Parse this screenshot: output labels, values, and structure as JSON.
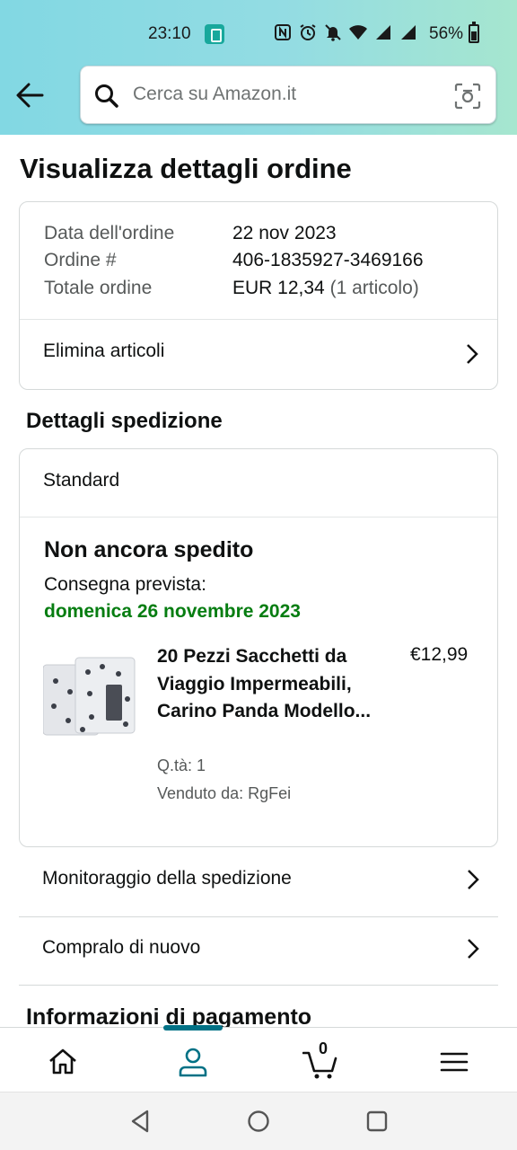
{
  "status_bar": {
    "time": "23:10",
    "battery": "56%",
    "icons": [
      "nfc-icon",
      "alarm-icon",
      "mute-icon",
      "wifi-icon",
      "signal-icon",
      "signal-icon",
      "battery-icon"
    ]
  },
  "header": {
    "search_placeholder": "Cerca su Amazon.it"
  },
  "page": {
    "title": "Visualizza dettagli ordine"
  },
  "order_summary": {
    "date_label": "Data dell'ordine",
    "date_value": "22 nov 2023",
    "order_label": "Ordine #",
    "order_value": "406-1835927-3469166",
    "total_label": "Totale ordine",
    "total_value": "EUR 12,34",
    "total_count": "(1 articolo)",
    "delete_items": "Elimina articoli"
  },
  "shipping": {
    "section_title": "Dettagli spedizione",
    "method": "Standard",
    "status": "Non ancora spedito",
    "delivery_label": "Consegna prevista:",
    "delivery_date": "domenica 26 novembre 2023",
    "product": {
      "name": "20 Pezzi Sacchetti da Viaggio Impermeabili, Carino Panda Modello...",
      "price": "€12,99",
      "qty": "Q.tà: 1",
      "seller": "Venduto da: RgFei"
    }
  },
  "actions": {
    "track": "Monitoraggio della spedizione",
    "buy_again": "Compralo di nuovo"
  },
  "payment": {
    "section_title": "Informazioni di pagamento"
  },
  "bottom_nav": {
    "cart_count": "0",
    "active": "account"
  },
  "colors": {
    "accent": "#007185",
    "delivery_green": "#067d11"
  }
}
